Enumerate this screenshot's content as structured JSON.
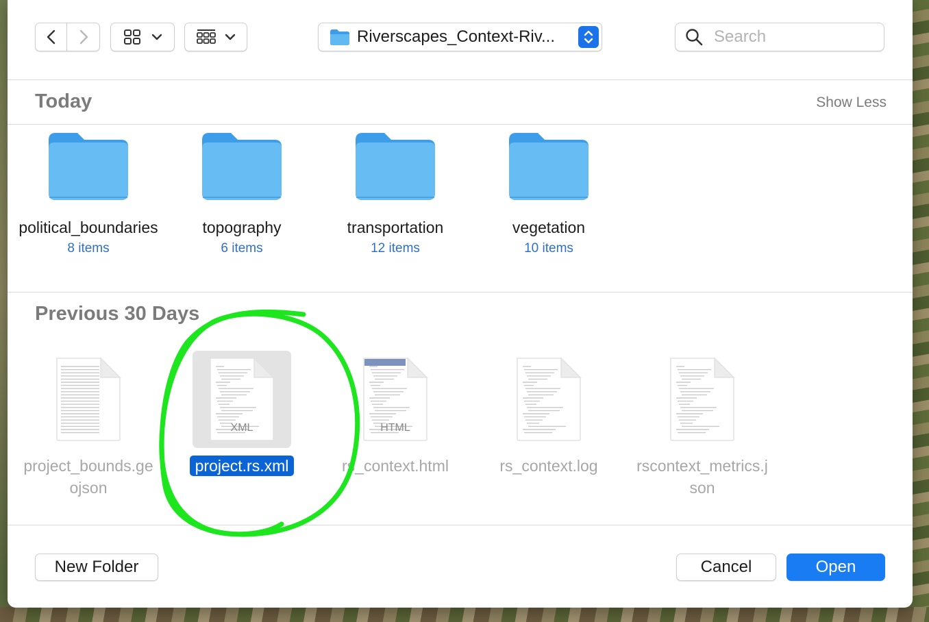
{
  "colors": {
    "accent": "#1a7cf3",
    "selection": "#0a64d6",
    "folder": "#5bb3ec",
    "link_blue": "#2f6fc7",
    "annotation": "#1ee61e"
  },
  "toolbar": {
    "back_icon": "chevron-left-icon",
    "forward_icon": "chevron-right-icon",
    "view_icon": "grid-icon",
    "group_icon": "group-grid-icon",
    "path_label": "Riverscapes_Context-Riv...",
    "search_placeholder": "Search"
  },
  "sections": {
    "today": {
      "title": "Today",
      "show_less": "Show Less",
      "folders": [
        {
          "name": "political_boundaries",
          "count": "8 items"
        },
        {
          "name": "topography",
          "count": "6 items"
        },
        {
          "name": "transportation",
          "count": "12 items"
        },
        {
          "name": "vegetation",
          "count": "10 items"
        }
      ]
    },
    "previous": {
      "title": "Previous 30 Days",
      "files": [
        {
          "name": "project_bounds.geojson",
          "badge": "",
          "selected": false
        },
        {
          "name": "project.rs.xml",
          "badge": "XML",
          "selected": true
        },
        {
          "name": "rs_context.html",
          "badge": "HTML",
          "selected": false
        },
        {
          "name": "rs_context.log",
          "badge": "",
          "selected": false
        },
        {
          "name": "rscontext_metrics.json",
          "badge": "",
          "selected": false
        }
      ]
    }
  },
  "footer": {
    "new_folder": "New Folder",
    "cancel": "Cancel",
    "open": "Open"
  }
}
